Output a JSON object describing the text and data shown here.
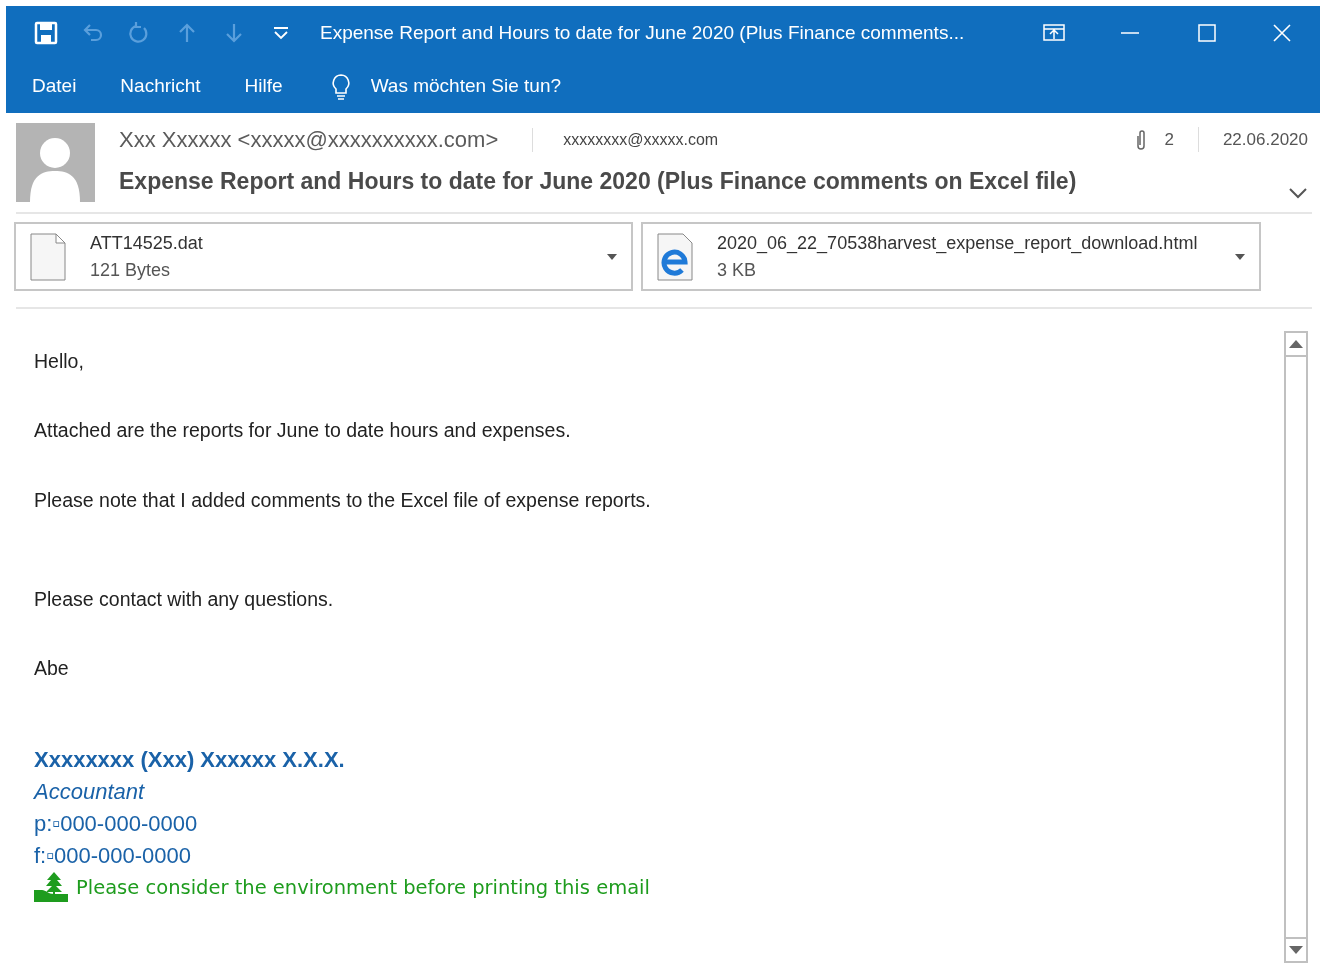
{
  "window": {
    "title": "Expense Report and Hours to date for June 2020 (Plus Finance comments..."
  },
  "menu": [
    {
      "label": "Datei"
    },
    {
      "label": "Nachricht"
    },
    {
      "label": "Hilfe"
    }
  ],
  "tell_me": {
    "placeholder": "Was möchten Sie tun?"
  },
  "header": {
    "sender": "Xxx Xxxxxx <xxxxx@xxxxxxxxxx.com>",
    "recipient": "xxxxxxxx@xxxxx.com",
    "attachment_count": "2",
    "date": "22.06.2020",
    "subject": "Expense Report and Hours to date for June 2020 (Plus Finance comments on Excel file)"
  },
  "attachments": [
    {
      "kind": "file",
      "name": "ATT14525.dat",
      "size": "121 Bytes"
    },
    {
      "kind": "html",
      "name": "2020_06_22_70538harvest_expense_report_download.html",
      "size": "3 KB"
    }
  ],
  "body": [
    "Hello,",
    "Attached are the reports for June to date hours and expenses.",
    "Please note that I added comments to the Excel file of expense reports.",
    "Please contact with any questions.",
    "Abe"
  ],
  "signature": {
    "name": "Xxxxxxxx (Xxx) Xxxxxx X.X.X.",
    "role": "Accountant",
    "phone": "p:▫000-000-0000",
    "fax": "f:▫000-000-0000",
    "eco_note": "Please consider the environment before printing this email"
  }
}
